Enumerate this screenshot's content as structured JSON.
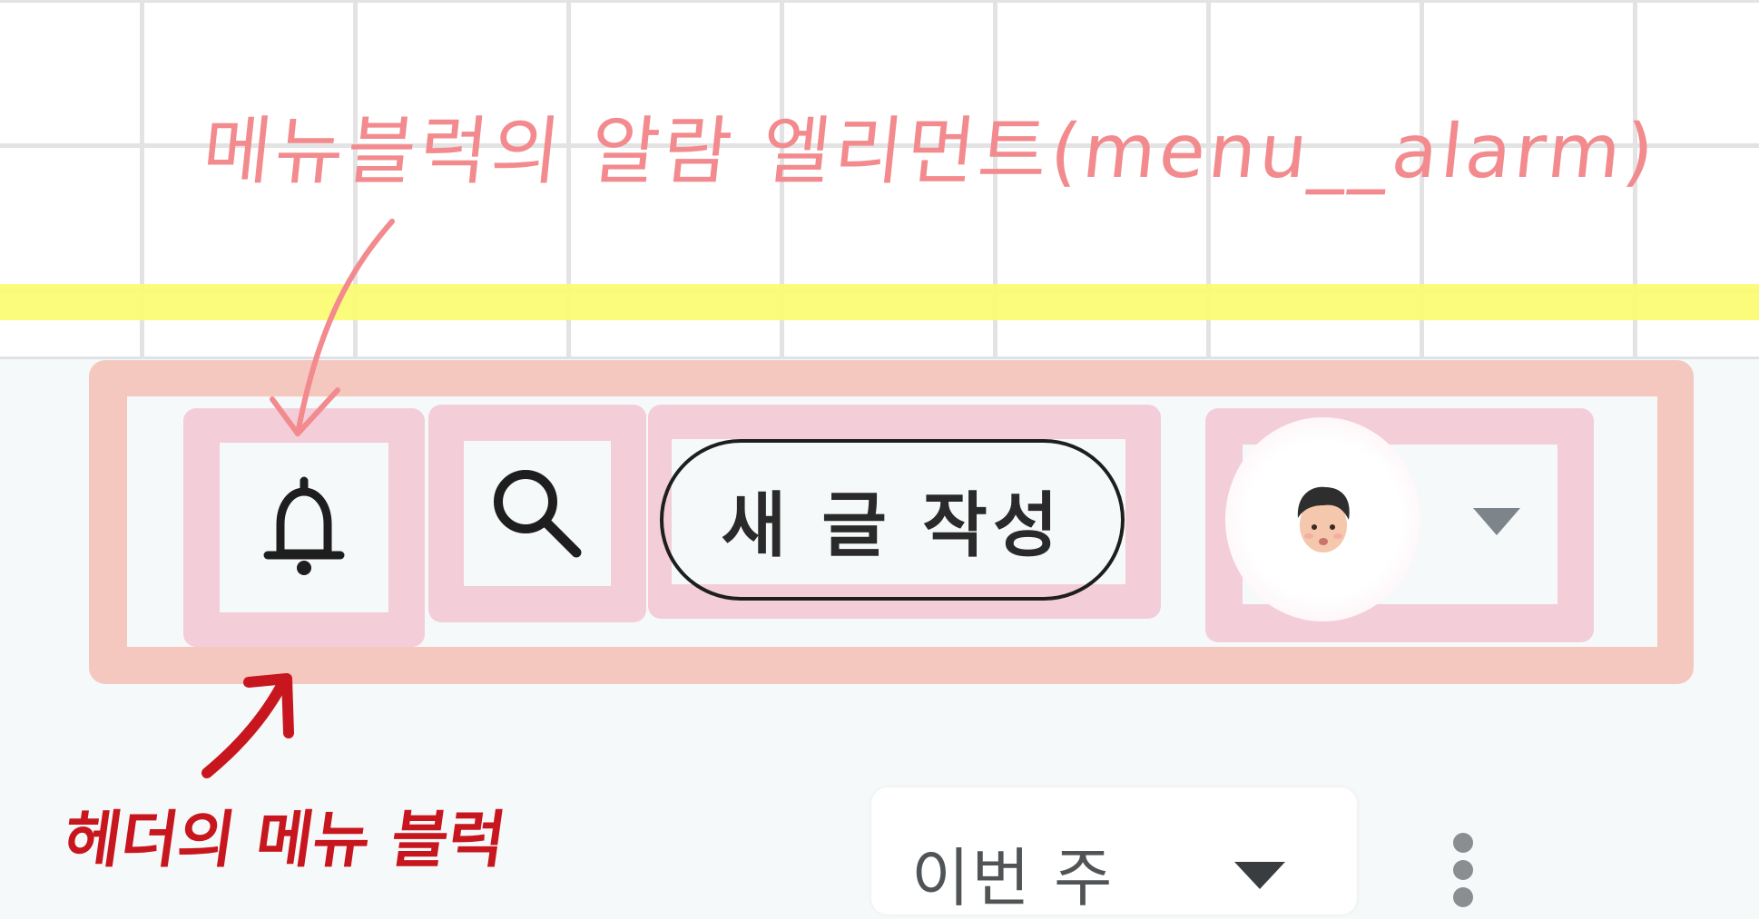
{
  "annotations": {
    "top_note": "메뉴블럭의 알람 엘리먼트(menu__alarm)",
    "bottom_note": "헤더의 메뉴 블럭"
  },
  "header_menu": {
    "alarm_icon": "bell-icon",
    "search_icon": "search-icon",
    "write_label": "새 글 작성",
    "profile_avatar": "avatar-face-icon",
    "profile_caret": "caret-down-icon"
  },
  "content": {
    "period_select_value": "이번 주",
    "period_caret": "caret-down-icon",
    "more_icon": "kebab-vertical-icon"
  },
  "colors": {
    "annotation_pink": "#f28a8e",
    "annotation_red": "#c8161e",
    "highlight_yellow": "#fcfc6e",
    "block_frame": "#f4c8bf",
    "item_frame": "#f3ced9"
  }
}
